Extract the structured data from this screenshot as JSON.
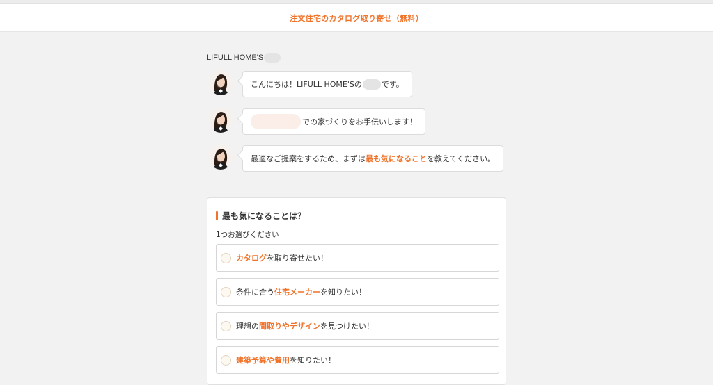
{
  "header": {
    "title": "注文住宅のカタログ取り寄せ（無料）"
  },
  "brand": {
    "name": "LIFULL HOME'S"
  },
  "chat": [
    {
      "pre": "こんにちは！LIFULL HOME'Sの",
      "post": "です。"
    },
    {
      "text": "での家づくりをお手伝いします！"
    },
    {
      "pre": "最適なご提案をするため、まずは",
      "highlight": "最も気になること",
      "post": "を教えてください。"
    }
  ],
  "question": {
    "title": "最も気になることは？",
    "subtitle": "1つお選びください",
    "options": [
      {
        "pre": "",
        "highlight": "カタログ",
        "post": "を取り寄せたい！"
      },
      {
        "pre": "条件に合う",
        "highlight": "住宅メーカー",
        "post": "を知りたい！"
      },
      {
        "pre": "理想の",
        "highlight": "間取りやデザイン",
        "post": "を見つけたい！"
      },
      {
        "pre": "",
        "highlight": "建築予算や費用",
        "post": "を知りたい！"
      }
    ]
  },
  "colors": {
    "accent": "#f0732a",
    "background": "#f2f2f2"
  }
}
